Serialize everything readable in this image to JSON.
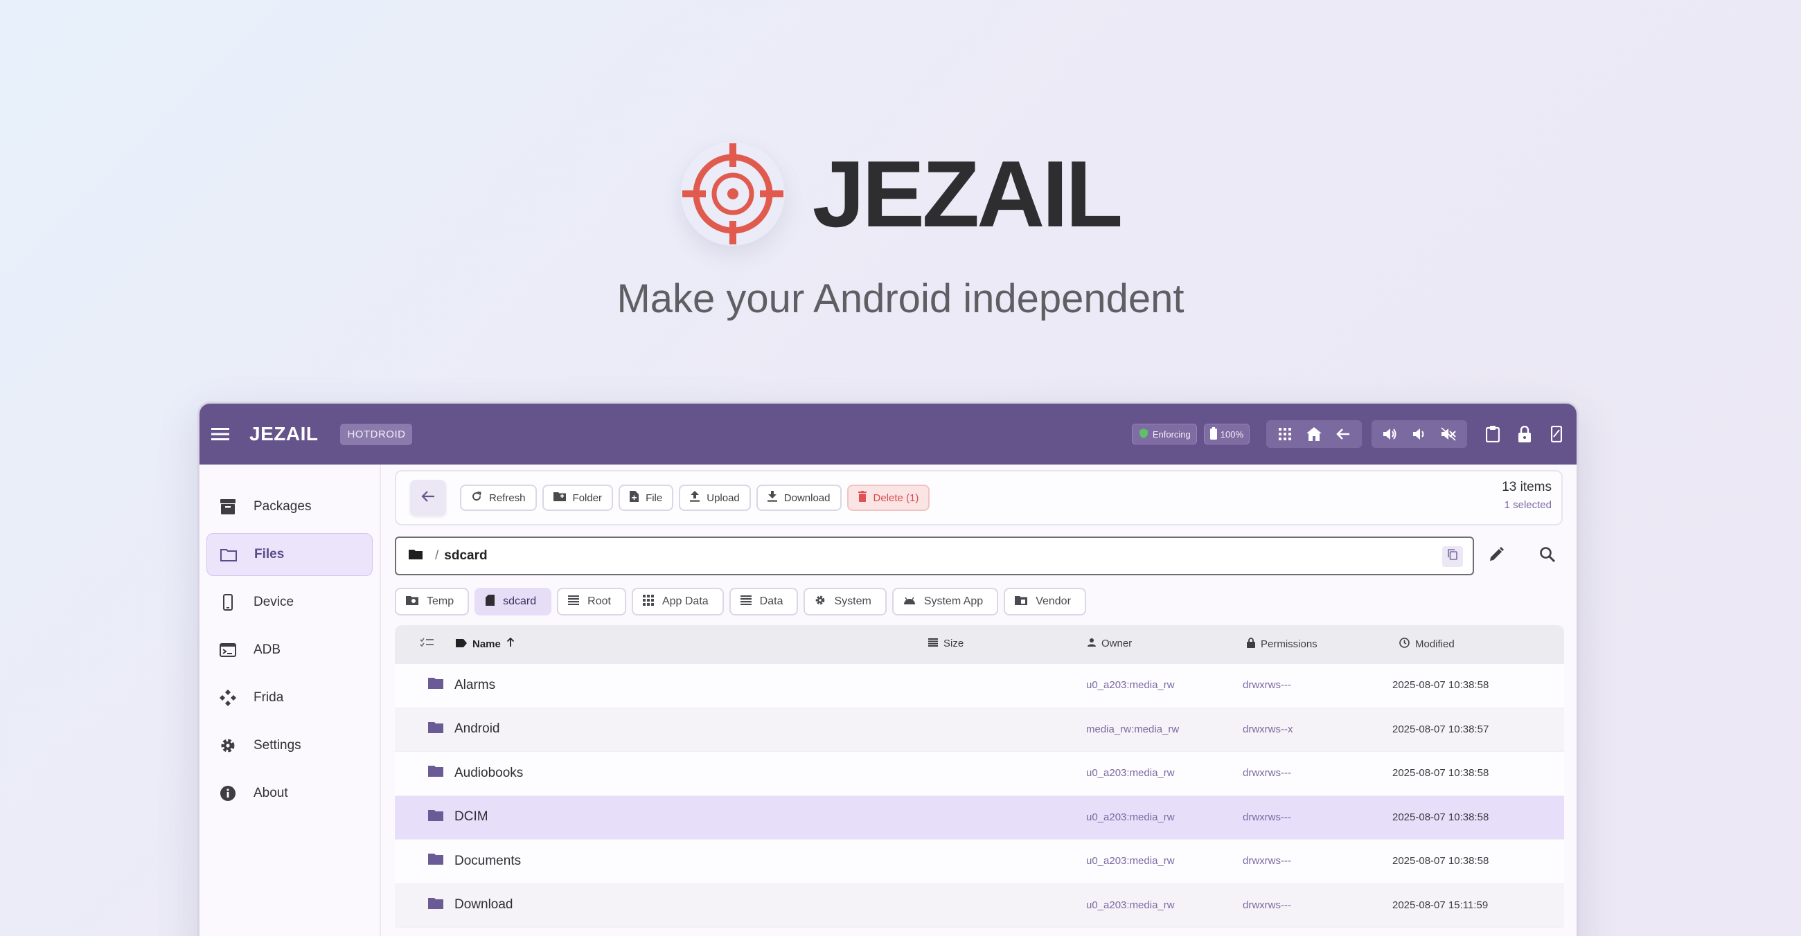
{
  "hero": {
    "title": "JEZAIL",
    "tagline": "Make your Android independent",
    "accent": "#e05a4e"
  },
  "app": {
    "brand": "JEZAIL",
    "device": "HOTDROID",
    "status": {
      "selinux": "Enforcing",
      "battery": "100%"
    },
    "topbar_color": "#65538c",
    "topbar_icons": [
      "apps-grid-icon",
      "home-icon",
      "back-arrow-icon",
      "volume-up-icon",
      "volume-down-icon",
      "volume-mute-icon",
      "clipboard-icon",
      "lock-icon",
      "phone-screen-icon"
    ]
  },
  "sidebar": {
    "items": [
      {
        "label": "Packages",
        "icon": "package-icon"
      },
      {
        "label": "Files",
        "icon": "folder-icon",
        "active": true
      },
      {
        "label": "Device",
        "icon": "phone-icon"
      },
      {
        "label": "ADB",
        "icon": "terminal-icon"
      },
      {
        "label": "Frida",
        "icon": "frida-icon"
      },
      {
        "label": "Settings",
        "icon": "gear-icon"
      },
      {
        "label": "About",
        "icon": "info-icon"
      }
    ]
  },
  "toolbar": {
    "refresh": "Refresh",
    "folder": "Folder",
    "file": "File",
    "upload": "Upload",
    "download": "Download",
    "delete": "Delete (1)",
    "items_count": "13 items",
    "selected_count": "1 selected"
  },
  "path": {
    "separator": "/",
    "segment": "sdcard"
  },
  "quick_locations": [
    "Temp",
    "sdcard",
    "Root",
    "App Data",
    "Data",
    "System",
    "System App",
    "Vendor"
  ],
  "table": {
    "columns": {
      "name": "Name",
      "size": "Size",
      "owner": "Owner",
      "permissions": "Permissions",
      "modified": "Modified"
    },
    "rows": [
      {
        "name": "Alarms",
        "owner": "u0_a203:media_rw",
        "permissions": "drwxrws---",
        "modified": "2025-08-07 10:38:58"
      },
      {
        "name": "Android",
        "owner": "media_rw:media_rw",
        "permissions": "drwxrws--x",
        "modified": "2025-08-07 10:38:57"
      },
      {
        "name": "Audiobooks",
        "owner": "u0_a203:media_rw",
        "permissions": "drwxrws---",
        "modified": "2025-08-07 10:38:58"
      },
      {
        "name": "DCIM",
        "owner": "u0_a203:media_rw",
        "permissions": "drwxrws---",
        "modified": "2025-08-07 10:38:58",
        "selected": true
      },
      {
        "name": "Documents",
        "owner": "u0_a203:media_rw",
        "permissions": "drwxrws---",
        "modified": "2025-08-07 10:38:58"
      },
      {
        "name": "Download",
        "owner": "u0_a203:media_rw",
        "permissions": "drwxrws---",
        "modified": "2025-08-07 15:11:59"
      }
    ]
  }
}
